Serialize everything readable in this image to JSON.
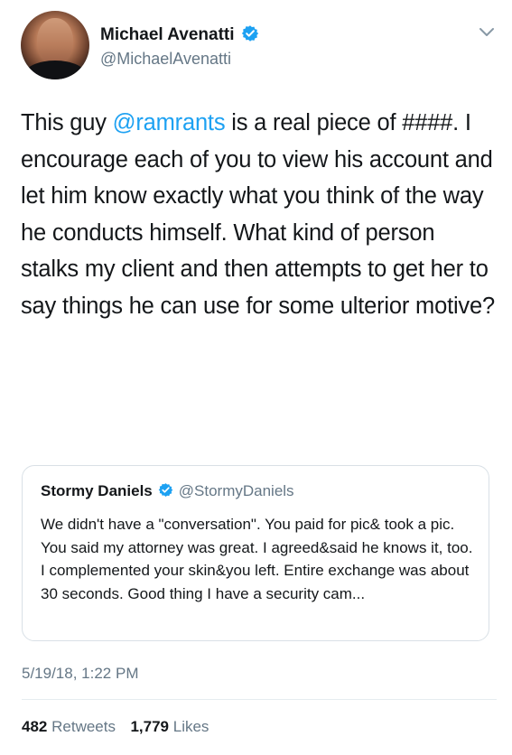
{
  "author": {
    "name": "Michael Avenatti",
    "handle": "@MichaelAvenatti",
    "verified": true
  },
  "tweet": {
    "text_before_mention": "This guy ",
    "mention": "@ramrants",
    "text_after_mention": " is a real piece of ####. I encourage each of you to view his account and let him know exactly what you think of the way he conducts himself. What kind of person stalks my client and then attempts to get her to say things he can use for some ulterior motive?"
  },
  "quoted_tweet": {
    "name": "Stormy Daniels",
    "handle": "@StormyDaniels",
    "verified": true,
    "text": "We didn't have a \"conversation\". You paid for pic& took a pic. You said my attorney was great. I agreed&said he knows it, too. I complemented your skin&you left. Entire exchange was about 30 seconds. Good thing I have a security cam..."
  },
  "timestamp": "5/19/18, 1:22 PM",
  "stats": {
    "retweets_count": "482",
    "retweets_label": "Retweets",
    "likes_count": "1,779",
    "likes_label": "Likes"
  },
  "icons": {
    "verified": "verified-badge-icon",
    "chevron": "chevron-down-icon"
  },
  "colors": {
    "verified": "#1da1f2",
    "link": "#1da1f2",
    "secondary_text": "#657786",
    "border": "#d9e0e6"
  }
}
